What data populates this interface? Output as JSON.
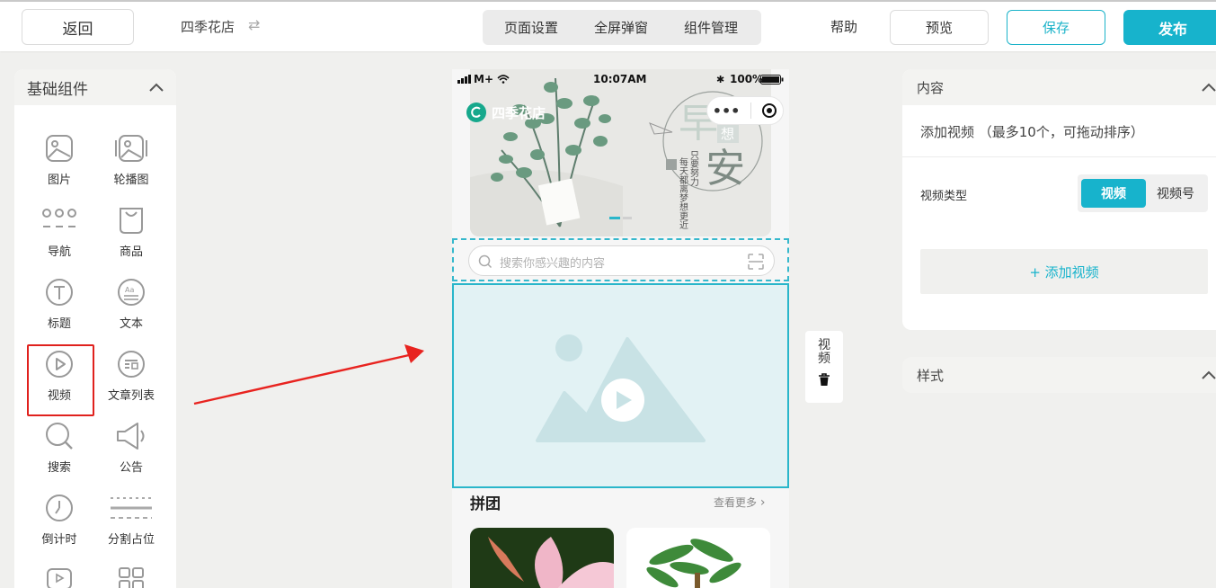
{
  "topbar": {
    "back_label": "返回",
    "shop_name": "四季花店",
    "tabs": [
      "页面设置",
      "全屏弹窗",
      "组件管理"
    ],
    "help_label": "帮助",
    "preview_label": "预览",
    "save_label": "保存",
    "publish_label": "发布"
  },
  "left_panel": {
    "title": "基础组件",
    "components": [
      {
        "label": "图片",
        "icon": "image-icon"
      },
      {
        "label": "轮播图",
        "icon": "carousel-icon"
      },
      {
        "label": "导航",
        "icon": "nav-grid-icon"
      },
      {
        "label": "商品",
        "icon": "bag-icon"
      },
      {
        "label": "标题",
        "icon": "title-icon"
      },
      {
        "label": "文本",
        "icon": "text-icon"
      },
      {
        "label": "视频",
        "icon": "play-circle-icon"
      },
      {
        "label": "文章列表",
        "icon": "article-list-icon"
      },
      {
        "label": "搜索",
        "icon": "search-icon"
      },
      {
        "label": "公告",
        "icon": "megaphone-icon"
      },
      {
        "label": "倒计时",
        "icon": "timer-icon"
      },
      {
        "label": "分割占位",
        "icon": "divider-icon"
      }
    ]
  },
  "phone": {
    "status": {
      "carrier": "M+",
      "time": "10:07AM",
      "battery": "100%"
    },
    "shop_title": "四季花店",
    "banner_text": {
      "big1": "早",
      "big2": "安",
      "small": "想",
      "vertical": [
        "只要努力",
        "每天都离梦想更近"
      ]
    },
    "search_placeholder": "搜索你感兴趣的内容",
    "group_title": "拼团",
    "more_label": "查看更多"
  },
  "side_tool": {
    "label": "视频"
  },
  "right_panel": {
    "content_title": "内容",
    "add_hint": "添加视频 （最多10个，可拖动排序）",
    "type_label": "视频类型",
    "type_options": [
      "视频",
      "视频号"
    ],
    "add_button": "+  添加视频",
    "style_title": "样式"
  },
  "colors": {
    "accent": "#17b3cc",
    "highlight": "#e0211d",
    "arrow": "#e8231f"
  }
}
